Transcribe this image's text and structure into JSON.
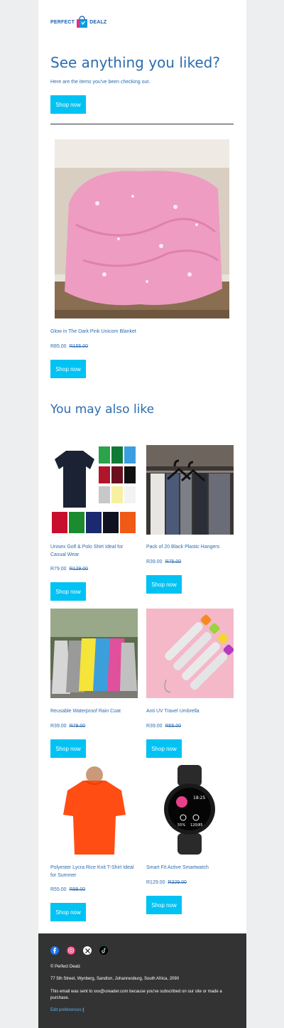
{
  "brand": {
    "left": "PERFECT",
    "right": "DEALZ"
  },
  "hero": {
    "title": "See anything you liked?",
    "subtitle": "Here are the items you've been checking out.",
    "cta": "Shop now"
  },
  "viewed": {
    "name": "Glow in The Dark Pink Unicorn Blanket",
    "price": "R85.00",
    "old_price": "R155.00",
    "cta": "Shop now"
  },
  "also_like": {
    "heading": "You may also like",
    "products": [
      {
        "name": "Unisex Golf & Polo Shirt Ideal for Casual Wear",
        "price": "R79.00",
        "old_price": "R129.00",
        "cta": "Shop now"
      },
      {
        "name": "Pack of 20 Black Plastic Hangers",
        "price": "R39.00",
        "old_price": "R75.00",
        "cta": "Shop now"
      },
      {
        "name": "Reusable Waterproof Rain Coat",
        "price": "R39.00",
        "old_price": "R79.00",
        "cta": "Shop now"
      },
      {
        "name": "Anti UV Travel Umbrella",
        "price": "R39.00",
        "old_price": "R55.00",
        "cta": "Shop now"
      },
      {
        "name": "Polyester Lycra Rice Knit T-Shirt Ideal for Summer",
        "price": "R55.00",
        "old_price": "R99.00",
        "cta": "Shop now"
      },
      {
        "name": "Smart Fit Active Smartwatch",
        "price": "R129.00",
        "old_price": "R329.00",
        "cta": "Shop now"
      }
    ]
  },
  "watch_screen": {
    "time": "18:25",
    "stat1": "55%",
    "stat2": "120/85"
  },
  "footer": {
    "social": [
      "facebook-icon",
      "instagram-icon",
      "x-icon",
      "tiktok-icon"
    ],
    "copyright": "© Perfect Dealz",
    "address": "77 5th Street, Wynberg, Sandton, Johannesburg, South Africa, 2090",
    "notice": "This email was sent to xxx@ureader.com because you've subscribed on our site or made a purchase.",
    "edit_prefs": "Edit preferences",
    "separator": "|"
  },
  "colors": {
    "accent": "#00c2f3",
    "text": "#2b6cb0",
    "footer_bg": "#333333",
    "page_bg": "#eceef0"
  }
}
